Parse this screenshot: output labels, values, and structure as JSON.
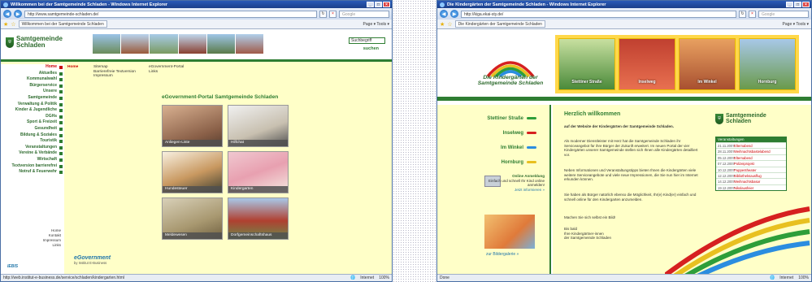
{
  "window1": {
    "title": "Willkommen bei der Samtgemeinde Schladen - Windows Internet Explorer",
    "url": "http://www.samtgemeinde-schladen.de/",
    "search_placeholder": "Google",
    "tab_label": "Willkommen bei der Samtgemeinde Schladen",
    "toolbar_right": "Page ▾  Tools ▾",
    "status_url": "http://web.institut-e-business.de/service/schladen/kindergarten.html",
    "status_zone": "Internet",
    "zoom": "100%",
    "logo": [
      "Samtgemeinde",
      "Schladen"
    ],
    "search_box": "Suchbegriff",
    "search_go": "suchen",
    "nav": [
      "Home",
      "Aktuelles",
      "Kommunalwahl",
      "Bürgerservice",
      "Unsere",
      "Samtgemeinde",
      "Verwaltung & Politik",
      "Kinder & Jugendliche",
      "DGHs",
      "Sport & Freizeit",
      "Gesundheit",
      "Bildung & Soziales",
      "Touristik",
      "Veranstaltungen",
      "Vereine & Verbände",
      "Wirtschaft",
      "Textversion barrierefrei",
      "Notruf & Feuerwehr"
    ],
    "breadcrumb": {
      "home": "Home",
      "col1": [
        "Sitemap",
        "Barrierefreie Textversion",
        "Impressum"
      ],
      "col2": [
        "eGovernment-Portal",
        "Links"
      ]
    },
    "footer_links": [
      "Home",
      "Kontakt",
      "Impressum",
      "Links"
    ],
    "footer_logo": "IEBIS",
    "portal_title": "eGovernment-Portal Samtgemeinde Schladen",
    "tiles": [
      "Anliegen-Liste",
      "Hilfchat",
      "Hundesteuer",
      "Kindergarten",
      "Meldewesen",
      "Dorfgemeinschaftshaus"
    ],
    "egov_logo": "eGovernment",
    "egov_sub": "by Institut E-Business"
  },
  "window2": {
    "title": "Die Kindergärten der Samtgemeinde Schladen - Windows Internet Explorer",
    "url": "http://kiga.ekai-sty.de/",
    "search_placeholder": "Google",
    "tab_label": "Die Kindergärten der Samtgemeinde Schladen",
    "toolbar_right": "Page ▾  Tools ▾",
    "status_left": "Done",
    "status_zone": "Internet",
    "zoom": "100%",
    "logo_line1": "Die Kindergärten der",
    "logo_line2": "Samtgemeinde Schladen",
    "thumbs": [
      "Stettiner Straße",
      "Inselweg",
      "Im Winkel",
      "Hornburg"
    ],
    "kitas": [
      {
        "name": "Stettiner Straße",
        "color": "#2e9e3a"
      },
      {
        "name": "Inselweg",
        "color": "#d62020"
      },
      {
        "name": "Im Winkel",
        "color": "#2b8de0"
      },
      {
        "name": "Hornburg",
        "color": "#e8c020"
      }
    ],
    "online_title": "Online Anmeldung",
    "online_text": "Einfach und schnell Ihr Kind online anmelden!",
    "online_more": "Jetzt informieren »",
    "gallery_link": "zur Bildergalerie »",
    "welcome": "Herzlich willkommen",
    "para1": "auf der Website der Kindergärten der Samtgemeinde Schladen.",
    "para2": "Als moderner Dienstleister mit Herz hat die Samtgemeinde Schladen ihr Serviceangebot für ihre Bürger der Zukunft erweitert. Im neuen Portal der vier Kindergärten unserer Samtgemeinde stellen sich Ihnen alle Kindergärten detailliert vor.",
    "para3": "Neben Informationen und Veranstaltungstipps bieten Ihnen die Kindergärten viele weitere Serviceangebote und viele neue Impressionen, die Sie nun hier im Internet erkunden können.",
    "para4": "Sie haben als Bürger natürlich ebenso die Möglichkeit, Ihr(e) Kind(er) einfach und schnell online für den Kindergarten anzumelden.",
    "para5": "Machen Sie sich selbst ein Bild!",
    "sign": [
      "Bis bald",
      "Ihre Kindergärtner-innen",
      "der Samtgemeinde Schladen"
    ],
    "sg_logo": [
      "Samtgemeinde",
      "Schladen"
    ],
    "events_title": "Veranstaltungen",
    "events": [
      {
        "date": "21.11.2007",
        "name": "Elternabend"
      },
      {
        "date": "28.11.2007",
        "name": "Weihnachtsbastelabend"
      },
      {
        "date": "05.12.2007",
        "name": "Elternabend"
      },
      {
        "date": "07.12.2007",
        "name": "Polizeiprojekt"
      },
      {
        "date": "10.12.2007",
        "name": "Puppentheater"
      },
      {
        "date": "12.12.2007",
        "name": "Bibliotheksausflug"
      },
      {
        "date": "14.12.2007",
        "name": "Weihnachtsbasar"
      },
      {
        "date": "19.12.2007",
        "name": "Nikolausfeier"
      }
    ]
  }
}
